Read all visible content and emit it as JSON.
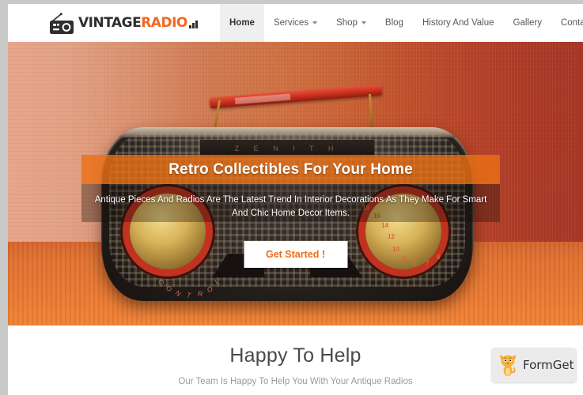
{
  "site": {
    "header": {
      "logo": {
        "icon": "vintage-radio-icon",
        "text_primary": "VINTAGE",
        "text_accent": "RADIO",
        "accent_color": "#f26722",
        "primary_color": "#2e2e2e"
      },
      "nav_items": [
        {
          "label": "Home",
          "active": true,
          "has_dropdown": false
        },
        {
          "label": "Services",
          "active": false,
          "has_dropdown": true
        },
        {
          "label": "Shop",
          "active": false,
          "has_dropdown": true
        },
        {
          "label": "Blog",
          "active": false,
          "has_dropdown": false
        },
        {
          "label": "History And Value",
          "active": false,
          "has_dropdown": false
        },
        {
          "label": "Gallery",
          "active": false,
          "has_dropdown": false
        },
        {
          "label": "Contact Us",
          "active": false,
          "has_dropdown": false
        }
      ]
    },
    "hero": {
      "title": "Retro Collectibles For Your Home",
      "subtitle": "Antique Pieces And Radios Are The Latest Trend In Interior Decorations As They Make For Smart And Chic Home Decor Items.",
      "cta_label": "Get Started !",
      "band_color": "#ec7014",
      "cta_text_color": "#ef6c1a",
      "image_alt": "Vintage Zenith tabletop radio with red carry handle on an orange table",
      "radio_brand": "Z E N I T H",
      "radio_control_label": "CONTROL",
      "tuning_marks": [
        "18",
        "16",
        "14",
        "12",
        "10",
        "9",
        "8",
        "7",
        "6"
      ]
    },
    "section": {
      "title": "Happy To Help",
      "subtitle": "Our Team Is Happy To Help You With Your Antique Radios"
    },
    "badge": {
      "label": "FormGet",
      "icon": "formget-cat-mascot-icon",
      "background": "#eceaea"
    }
  }
}
